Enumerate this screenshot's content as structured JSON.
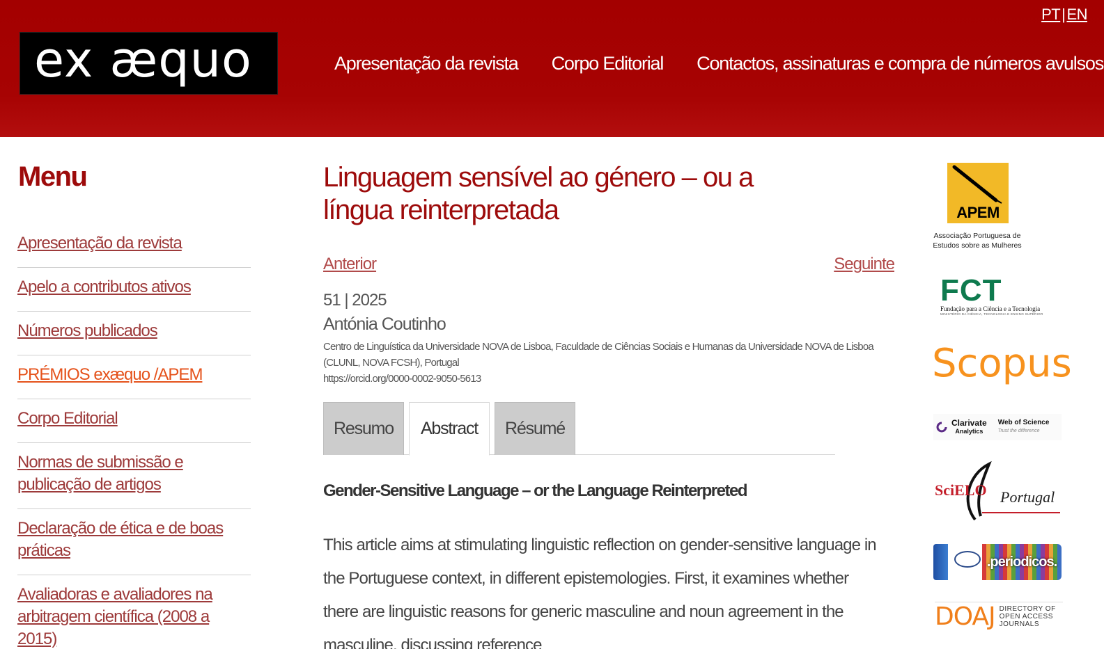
{
  "header": {
    "logo_text": "ex æquo",
    "lang_pt": "PT",
    "lang_sep": "|",
    "lang_en": "EN",
    "nav": [
      "Apresentação da revista",
      "Corpo Editorial",
      "Contactos, assinaturas e compra de números avulsos"
    ]
  },
  "sidebar": {
    "title": "Menu",
    "items": [
      "Apresentação da revista",
      "Apelo a contributos ativos",
      "Números publicados",
      "PRÉMIOS exæquo /APEM",
      "Corpo Editorial",
      "Normas de submissão e publicação de artigos",
      "Declaração de ética e de boas práticas",
      "Avaliadoras e avaliadores na arbitragem científica (2008 a 2015)"
    ]
  },
  "article": {
    "title": "Linguagem sensível ao género – ou a língua reinterpretada",
    "prev": "Anterior",
    "next": "Seguinte",
    "issue": "51 | 2025",
    "author": "Antónia Coutinho",
    "affiliation": "Centro de Linguística da Universidade NOVA de Lisboa, Faculdade de Ciências Sociais e Humanas da Universidade NOVA de Lisboa (CLUNL, NOVA FCSH), Portugal",
    "orcid": "https://orcid.org/0000-0002-9050-5613",
    "tabs": [
      "Resumo",
      "Abstract",
      "Résumé"
    ],
    "active_tab": "Abstract",
    "abstract_title": "Gender-Sensitive Language – or the Language Reinterpreted",
    "abstract_text": "This article aims at stimulating linguistic reflection on gender-sensitive language in the Portuguese context, in different epistemologies. First, it examines whether there are linguistic reasons for generic masculine and noun agreement in the masculine, discussing reference"
  },
  "logos": {
    "apem_word": "APEM",
    "apem_caption": "Associação Portuguesa de Estudos sobre as Mulheres",
    "fct_big": "FCT",
    "fct_small": "Fundação para a Ciência e a Tecnologia",
    "fct_tiny": "MINISTÉRIO DA CIÊNCIA, TECNOLOGIA E ENSINO SUPERIOR",
    "scopus": "Scopus",
    "clarivate": "Clarivate",
    "clarivate_sub": "Analytics",
    "wos": "Web of Science",
    "wos_sub": "Trust the difference",
    "scielo": "SciELO",
    "scielo_pt": "Portugal",
    "periodicos": ".periodicos.",
    "doaj": "DOAJ",
    "doaj_desc": "DIRECTORY OF OPEN ACCESS JOURNALS"
  },
  "colors": {
    "header_bg": "#a30000",
    "title_red": "#9d0b0b",
    "link": "#9d3a3a",
    "accent_orange": "#e5521b"
  }
}
